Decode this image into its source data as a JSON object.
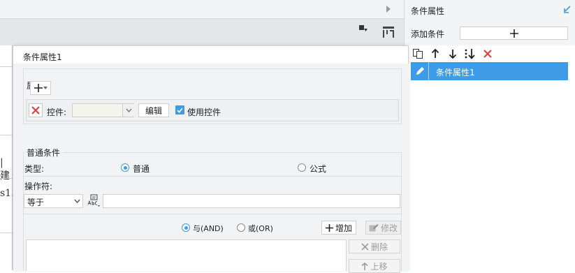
{
  "right_pane": {
    "title": "条件属性",
    "add_condition_label": "添加条件",
    "list_items": [
      {
        "label": "条件属性1"
      }
    ]
  },
  "dialog": {
    "title": "条件属性1",
    "properties": {
      "legend": "属性",
      "control_label": "控件:",
      "control_value": "",
      "edit_label": "编辑",
      "use_control_label": "使用控件",
      "use_control_checked": true
    },
    "normal_condition": {
      "legend": "普通条件",
      "type_label": "类型:",
      "type_options": [
        "普通",
        "公式"
      ],
      "type_selected": "普通",
      "operator_label": "操作符:",
      "operator_value": "等于",
      "operator_input_value": "",
      "logic_options": [
        "与(AND)",
        "或(OR)"
      ],
      "logic_selected": "与(AND)",
      "add_label": "增加",
      "modify_label": "修改",
      "delete_label": "删除",
      "move_up_label": "上移"
    }
  },
  "background": {
    "fragments": [
      "|建",
      "s1."
    ]
  },
  "colors": {
    "accent": "#3e9be5",
    "delete_red": "#e03c3c",
    "panel_bg": "#f2f3f5"
  }
}
